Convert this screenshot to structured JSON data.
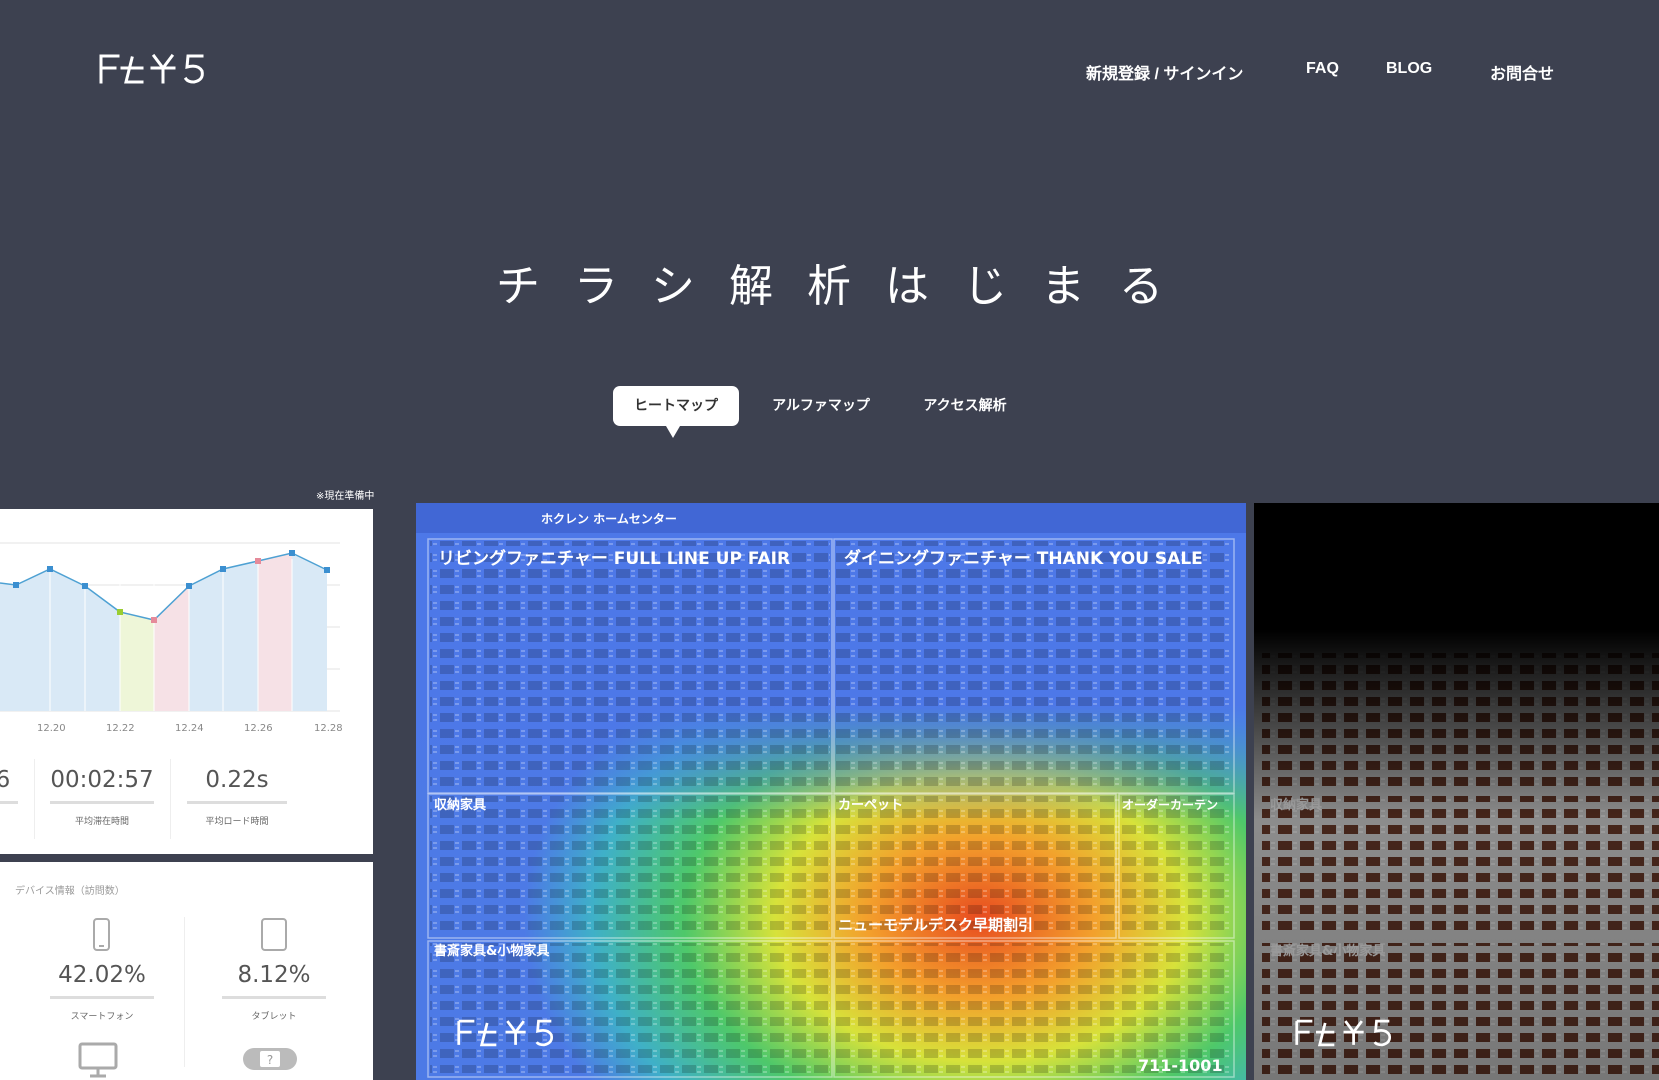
{
  "brand": {
    "name": "FLY5"
  },
  "nav": {
    "register": "新規登録 / サインイン",
    "faq": "FAQ",
    "blog": "BLOG",
    "contact": "お問合せ"
  },
  "hero": {
    "headline": "チラシ解析はじまる"
  },
  "tabs": [
    {
      "label": "ヒートマップ",
      "active": true
    },
    {
      "label": "アルファマップ",
      "active": false
    },
    {
      "label": "アクセス解析",
      "active": false
    }
  ],
  "note": "※現在準備中",
  "dashboard": {
    "chart_ticks": [
      "12.20",
      "12.22",
      "12.24",
      "12.26",
      "12.28"
    ],
    "stats": [
      {
        "value": "6",
        "label": ""
      },
      {
        "value": "00:02:57",
        "label": "平均滞在時間"
      },
      {
        "value": "0.22s",
        "label": "平均ロード時間"
      }
    ],
    "devices_title": "デバイス情報（訪問数）",
    "devices": [
      {
        "icon": "smartphone-icon",
        "value": "42.02%",
        "label": "スマートフォン"
      },
      {
        "icon": "tablet-icon",
        "value": "8.12%",
        "label": "タブレット"
      },
      {
        "icon": "desktop-icon",
        "value": "",
        "label": ""
      },
      {
        "icon": "game-console-icon",
        "value": "",
        "label": ""
      }
    ]
  },
  "flyer": {
    "store": "ホクレン ホームセンター",
    "sections": [
      "リビングファニチャー FULL LINE UP FAIR",
      "ダイニングファニチャー THANK YOU SALE",
      "収納家具",
      "カーペット",
      "オーダーカーテン",
      "書斎家具&小物家具"
    ],
    "banner": "ニューモデルデスク早期割引",
    "phone": "711-1001"
  },
  "colors": {
    "background": "#3d4150",
    "panel_dark": "#000000"
  }
}
